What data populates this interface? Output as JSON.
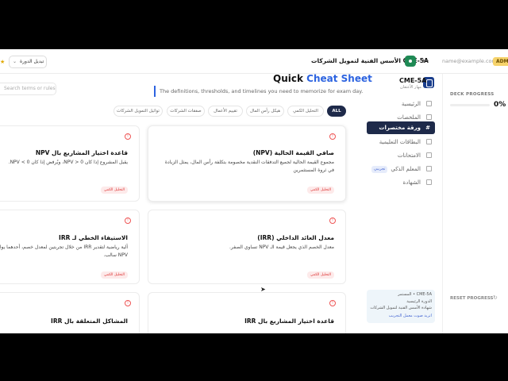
{
  "topbar": {
    "admin_badge": "ADMIN",
    "user_email": "name@example.com",
    "course_title": "الأسس الفنية لتمويل الشركات CME-5A",
    "switch_course": "تبديل الدورة"
  },
  "sidebar": {
    "course_code": "CME-5A",
    "course_sub": "مهار الأعتقان",
    "items": [
      {
        "label": "الرئيسية"
      },
      {
        "label": "الملخصات"
      },
      {
        "label": "ورقة مختصرات"
      },
      {
        "label": "البطاقات التعليمية"
      },
      {
        "label": "الامتحانات"
      },
      {
        "label": "المعلم الذكي",
        "badge": "تجريبي"
      },
      {
        "label": "الشهادة"
      }
    ],
    "card": {
      "line1": "المستمر • CME-5A",
      "line2": "الدورة الرئيسية",
      "line3": "شهادة الأسس الفنية لتمويل الشركات",
      "line4": "اتريد صوت معمل التجريب"
    }
  },
  "panel": {
    "deck_progress_label": "DECK PROGRESS",
    "deck_progress_value": "0%",
    "deck_progress_fraction": 0,
    "reset_progress": "RESET PROGRESS"
  },
  "main": {
    "search_placeholder": "Search terms or rules",
    "title_plain": "Quick ",
    "title_accent": "Cheat Sheet",
    "subtitle": "The definitions, thresholds, and timelines you need to memorize for exam day.",
    "tabs": [
      "ALL",
      "التحليل الكمي",
      "هيكل رأس المال",
      "تقييم الأعمال",
      "صفقات الشركات",
      "تواثيل التمويل الشركات"
    ],
    "cards": [
      {
        "title": "صافي القيمة الحالية (NPV)",
        "body": "مجموع القيمة الحالية لجميع التدفقات النقدية مخصومة بتكلفة رأس المال، يمثل الزيادة في ثروة المستثمرين",
        "tag": "التحليل الكمي"
      },
      {
        "title": "قاعدة اختيار المشاريع بال NPV",
        "body": "يقبل المشروع إذا كان 0 < NPV، ويُرفض إذا كان 0 > NPV.",
        "tag": "التحليل الكمي"
      },
      {
        "title": "معدل العائد الداخلي (IRR)",
        "body": "معدل الخصم الذي يجعل قيمة الـ NPV تساوي الصفر.",
        "tag": "التحليل الكمي"
      },
      {
        "title": "الاستيفاء الخطي لـ IRR",
        "body": "آلية رياضية لتقدير IRR من خلال تجربتين لمعدل خصم، أحدهما يولد NPV سالب.",
        "tag": "التحليل الكمي"
      },
      {
        "title": "قاعدة اختيار المشاريع بال IRR",
        "body": "",
        "tag": ""
      },
      {
        "title": "المشاكل المتعلقة بال IRR",
        "body": "",
        "tag": ""
      }
    ]
  },
  "colors": {
    "navy": "#1e2a4a",
    "accent": "#2c63e0",
    "tag_bg": "#fdeaea",
    "tag_fg": "#d33"
  }
}
